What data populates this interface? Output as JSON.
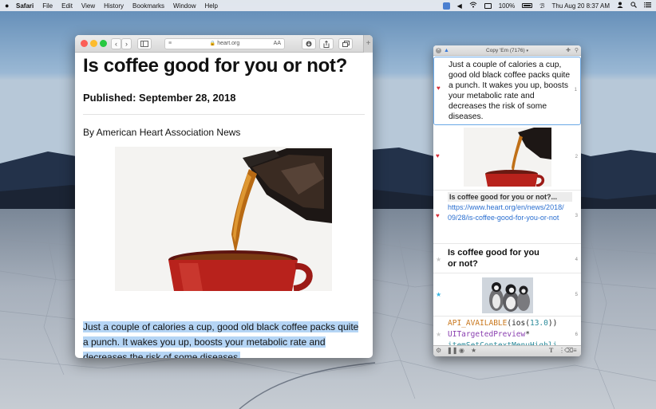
{
  "menubar": {
    "apple": "",
    "app": "Safari",
    "menus": [
      "File",
      "Edit",
      "View",
      "History",
      "Bookmarks",
      "Window",
      "Help"
    ],
    "battery": "100%",
    "clock": "Thu Aug 20  8:37 AM"
  },
  "safari": {
    "url": "heart.org",
    "reader_label": "≡",
    "text_size_label": "AA",
    "new_tab": "+",
    "article": {
      "title": "Is coffee good for you or not?",
      "published": "Published: September 28, 2018",
      "byline": "By American Heart Association News",
      "body_highlighted": "Just a couple of calories a cup, good old black coffee packs quite a punch. It wakes you up, boosts your metabolic rate and decreases the risk of some diseases."
    }
  },
  "copyem": {
    "title": "Copy 'Em (7176)",
    "clips": [
      {
        "num": "1",
        "mark": "heart",
        "text": "Just a couple of calories a cup, good old black coffee packs quite a punch. It wakes you up, boosts your metabolic rate and decreases the risk of some diseases."
      },
      {
        "num": "2",
        "mark": "heart",
        "kind": "image"
      },
      {
        "num": "3",
        "mark": "heart",
        "link_title": "Is coffee good for you or not?...",
        "link_url": "https://www.heart.org/en/news/2018/09/28/is-coffee-good-for-you-or-not"
      },
      {
        "num": "4",
        "mark": "star",
        "text": "Is coffee good for you or not?"
      },
      {
        "num": "5",
        "mark": "star-blue",
        "kind": "image"
      },
      {
        "num": "6",
        "mark": "star",
        "code": {
          "line1_name": "API_AVAILABLE",
          "line1_open": "(ios(",
          "line1_num": "13.0",
          "line1_close": "))",
          "line2_type": "UITargetedPreview",
          "line2_star": "*",
          "line3": "itemSetContextMenuHighli"
        }
      }
    ]
  },
  "colors": {
    "accent": "#3a7ad8",
    "highlight": "#b5d5f5",
    "heart": "#d6303a",
    "code_orange": "#c9771c",
    "code_purple": "#8a3fb0",
    "code_teal": "#2a8a9a"
  }
}
